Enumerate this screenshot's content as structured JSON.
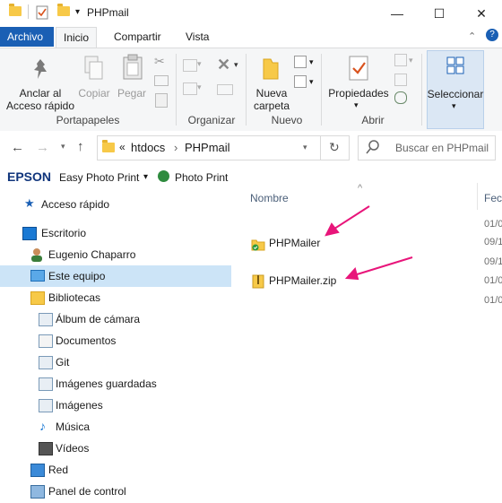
{
  "window": {
    "title": "PHPmail",
    "quick_access_dropdown": "▾",
    "minimize": "—",
    "maximize": "☐",
    "close": "✕"
  },
  "tabs": [
    {
      "label": "Archivo"
    },
    {
      "label": "Inicio"
    },
    {
      "label": "Compartir"
    },
    {
      "label": "Vista"
    }
  ],
  "ribbon": {
    "pin_label_1": "Anclar al",
    "pin_label_2": "Acceso rápido",
    "copy": "Copiar",
    "paste": "Pegar",
    "new_folder_1": "Nueva",
    "new_folder_2": "carpeta",
    "properties": "Propiedades",
    "select": "Seleccionar",
    "groups": {
      "clipboard": "Portapapeles",
      "organize": "Organizar",
      "new": "Nuevo",
      "open": "Abrir"
    },
    "dropdown_arrow": "▾",
    "collapse": "⌃",
    "help": "?"
  },
  "address": {
    "overflow": "«",
    "crumbs": [
      "htdocs",
      "PHPmail"
    ],
    "separator": "›",
    "search_placeholder": "Buscar en PHPmail"
  },
  "epson": {
    "brand": "EPSON",
    "app": "Easy Photo Print",
    "photo_print": "Photo Print",
    "caret": "▾"
  },
  "nav": [
    {
      "label": "Acceso rápido",
      "icon": "star-icon"
    },
    {
      "label": "Escritorio",
      "icon": "desktop-icon"
    },
    {
      "label": "Eugenio Chaparro",
      "icon": "user-icon"
    },
    {
      "label": "Este equipo",
      "icon": "computer-icon",
      "selected": true
    },
    {
      "label": "Bibliotecas",
      "icon": "libraries-icon"
    },
    {
      "label": "Álbum de cámara",
      "icon": "library-folder-icon"
    },
    {
      "label": "Documentos",
      "icon": "documents-icon"
    },
    {
      "label": "Git",
      "icon": "library-folder-icon"
    },
    {
      "label": "Imágenes guardadas",
      "icon": "library-folder-icon"
    },
    {
      "label": "Imágenes",
      "icon": "library-folder-icon"
    },
    {
      "label": "Música",
      "icon": "music-icon"
    },
    {
      "label": "Vídeos",
      "icon": "videos-icon"
    },
    {
      "label": "Red",
      "icon": "network-icon"
    },
    {
      "label": "Panel de control",
      "icon": "control-panel-icon"
    }
  ],
  "columns": {
    "name": "Nombre",
    "date": "Fech",
    "sort_indicator": "^"
  },
  "files": [
    {
      "name": "PHPMailer",
      "type": "folder"
    },
    {
      "name": "PHPMailer.zip",
      "type": "zip"
    }
  ],
  "dates_partial": [
    "01/0",
    "09/1",
    "09/1",
    "01/0",
    "01/0"
  ],
  "annotation_color": "#e8157a",
  "accent": "#1a5fb4"
}
